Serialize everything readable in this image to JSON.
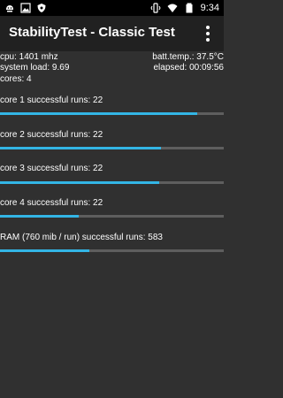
{
  "status_bar": {
    "time": "9:34",
    "left_icons": [
      "android-debug-icon",
      "image-icon",
      "shield-icon"
    ],
    "right_icons": [
      "vibrate-icon",
      "wifi-icon",
      "battery-icon"
    ]
  },
  "app_bar": {
    "title": "StabilityTest - Classic Test",
    "menu_icon": "overflow-menu-icon"
  },
  "stats": {
    "cpu": "cpu: 1401 mhz",
    "batt_temp": "batt.temp.: 37.5°C",
    "system_load": "system load: 9.69",
    "elapsed": "elapsed: 00:09:56",
    "cores": "cores: 4"
  },
  "tests": [
    {
      "label": "core 1 successful runs: 22",
      "progress": 0.88
    },
    {
      "label": "core 2 successful runs: 22",
      "progress": 0.72
    },
    {
      "label": "core 3 successful runs: 22",
      "progress": 0.71
    },
    {
      "label": "core 4 successful runs: 22",
      "progress": 0.35
    },
    {
      "label": "RAM (760 mib / run) successful runs: 583",
      "progress": 0.4
    }
  ],
  "colors": {
    "accent": "#33b5e5",
    "track": "#5e5e5e",
    "background": "#303030",
    "app_bar": "#212121"
  }
}
